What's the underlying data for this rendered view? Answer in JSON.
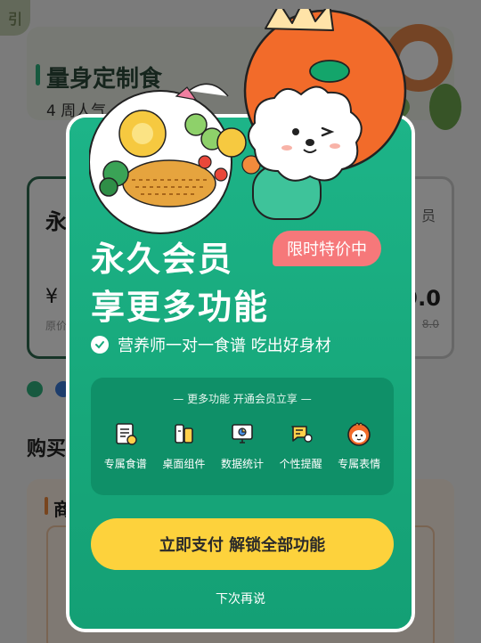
{
  "background": {
    "app_badge": "引",
    "heading": "量身定制食",
    "subtitle": "4 周人气",
    "plan_left": {
      "title": "永",
      "price": "¥",
      "original": "原价"
    },
    "plan_right": {
      "title": "员",
      "price": "9.0",
      "original": "8.0"
    },
    "section_title": "购买",
    "bottom_title": "商"
  },
  "modal": {
    "headline_line1": "永久会员",
    "headline_line2": "享更多功能",
    "promo_badge": "限时特价中",
    "benefit": "营养师一对一食谱 吃出好身材",
    "features_title": "— 更多功能  开通会员立享 —",
    "features": [
      {
        "label": "专属食谱",
        "icon": "recipe-icon"
      },
      {
        "label": "桌面组件",
        "icon": "widget-icon"
      },
      {
        "label": "数据统计",
        "icon": "stats-icon"
      },
      {
        "label": "个性提醒",
        "icon": "reminder-icon"
      },
      {
        "label": "专属表情",
        "icon": "sticker-icon"
      }
    ],
    "pay_button": "立即支付  解锁全部功能",
    "later_link": "下次再说"
  },
  "colors": {
    "modal_green": "#18a97c",
    "promo_red": "#f6787a",
    "button_yellow": "#fdd23c",
    "mascot_orange": "#f26b2a"
  }
}
